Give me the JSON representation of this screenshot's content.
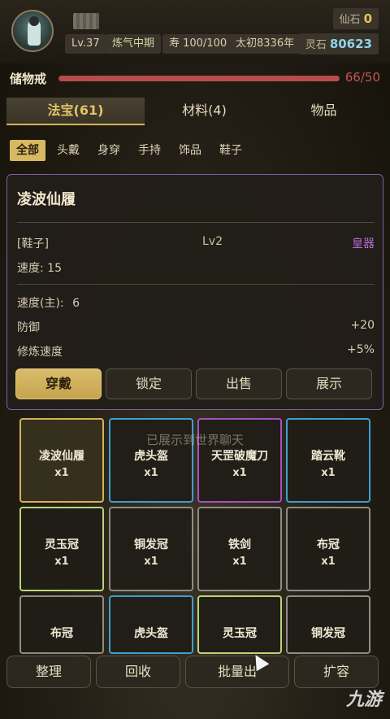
{
  "header": {
    "level": "Lv.37",
    "realm": "炼气中期",
    "lifespan": "寿 100/100",
    "era": "太初8336年",
    "immortal_stone_label": "仙石",
    "immortal_stone_value": "0",
    "spirit_stone_label": "灵石",
    "spirit_stone_value": "80623"
  },
  "storage": {
    "label": "储物戒",
    "count": "66/50",
    "fill_percent": 100
  },
  "tabs": [
    {
      "label": "法宝(61)",
      "active": true
    },
    {
      "label": "材料(4)",
      "active": false
    },
    {
      "label": "物品",
      "active": false
    }
  ],
  "filters": [
    {
      "label": "全部",
      "active": true
    },
    {
      "label": "头戴"
    },
    {
      "label": "身穿"
    },
    {
      "label": "手持"
    },
    {
      "label": "饰品"
    },
    {
      "label": "鞋子"
    }
  ],
  "detail": {
    "title": "凌波仙履",
    "slot": "[鞋子]",
    "level": "Lv2",
    "quality": "皇器",
    "speed": "速度: 15",
    "main_speed_label": "速度(主):",
    "main_speed_value": "6",
    "defense_label": "防御",
    "defense_value": "+20",
    "cultivation_label": "修炼速度",
    "cultivation_value": "+5%",
    "actions": [
      "穿戴",
      "锁定",
      "出售",
      "展示"
    ]
  },
  "notice": "已展示到世界聊天",
  "items": [
    {
      "name": "凌波仙履",
      "qty": "x1",
      "quality": "gold"
    },
    {
      "name": "虎头盔",
      "qty": "x1",
      "quality": "blue"
    },
    {
      "name": "天罡破魔刀",
      "qty": "x1",
      "quality": "purple"
    },
    {
      "name": "踏云靴",
      "qty": "x1",
      "quality": "blue"
    },
    {
      "name": "灵玉冠",
      "qty": "x1",
      "quality": "lime"
    },
    {
      "name": "铜发冠",
      "qty": "x1",
      "quality": "gray"
    },
    {
      "name": "铁剑",
      "qty": "x1",
      "quality": "gray"
    },
    {
      "name": "布冠",
      "qty": "x1",
      "quality": "gray"
    },
    {
      "name": "布冠",
      "qty": "",
      "quality": "gray"
    },
    {
      "name": "虎头盔",
      "qty": "",
      "quality": "blue"
    },
    {
      "name": "灵玉冠",
      "qty": "",
      "quality": "lime"
    },
    {
      "name": "铜发冠",
      "qty": "",
      "quality": "gray"
    }
  ],
  "bottom_buttons": [
    "整理",
    "回收",
    "批量出",
    "扩容"
  ],
  "watermark": "九游",
  "colors": {
    "accent_gold": "#d7b863",
    "storage_red": "#b94b4b",
    "quality_purple": "#a64fc7",
    "quality_blue": "#3f9ed1"
  }
}
